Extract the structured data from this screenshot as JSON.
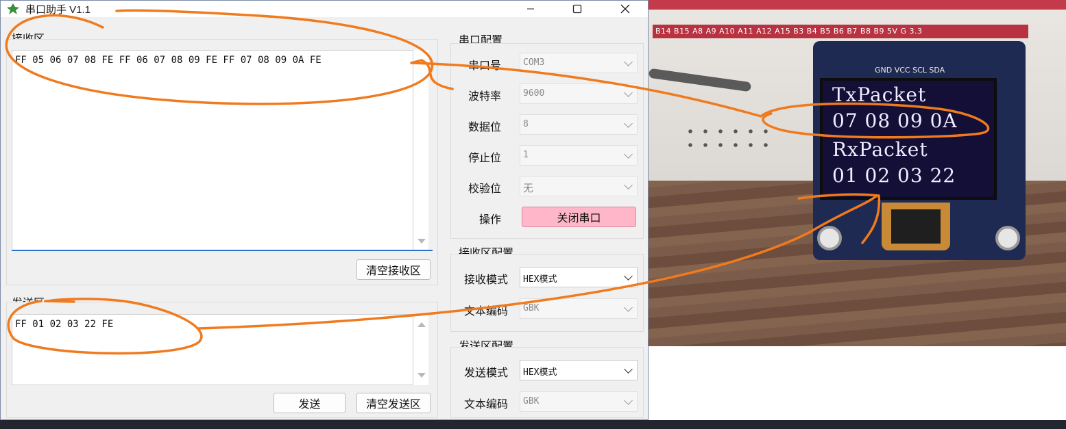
{
  "window": {
    "title": "串口助手 V1.1"
  },
  "receive": {
    "group_label": "接收区",
    "content": "FF 05 06 07 08 FE FF 06 07 08 09 FE FF 07 08 09 0A FE",
    "clear_label": "清空接收区"
  },
  "send": {
    "group_label": "发送区",
    "content": "FF 01 02 03 22 FE",
    "send_label": "发送",
    "clear_label": "清空发送区"
  },
  "serial_config": {
    "group_label": "串口配置",
    "port": {
      "label": "串口号",
      "value": "COM3"
    },
    "baud": {
      "label": "波特率",
      "value": "9600"
    },
    "databits": {
      "label": "数据位",
      "value": "8"
    },
    "stopbits": {
      "label": "停止位",
      "value": "1"
    },
    "parity": {
      "label": "校验位",
      "value": "无"
    },
    "operation": {
      "label": "操作",
      "button": "关闭串口"
    }
  },
  "receive_config": {
    "group_label": "接收区配置",
    "mode": {
      "label": "接收模式",
      "value": "HEX模式"
    },
    "encoding": {
      "label": "文本编码",
      "value": "GBK"
    }
  },
  "send_config": {
    "group_label": "发送区配置",
    "mode": {
      "label": "发送模式",
      "value": "HEX模式"
    },
    "encoding": {
      "label": "文本编码",
      "value": "GBK"
    }
  },
  "photo": {
    "pin_header": "B14 B15 A8 A9 A10 A11 A12 A15 B3 B4 B5 B6 B7 B8 B9 5V G 3.3",
    "oled_pins": "GND VCC SCL SDA",
    "oled_lines": [
      "TxPacket",
      "07 08 09 0A",
      "RxPacket",
      "01 02 03 22"
    ]
  },
  "colors": {
    "accent_blue": "#2f6fc6",
    "danger_pink": "#ffb6c9",
    "annotation_orange": "#f07a1e"
  }
}
